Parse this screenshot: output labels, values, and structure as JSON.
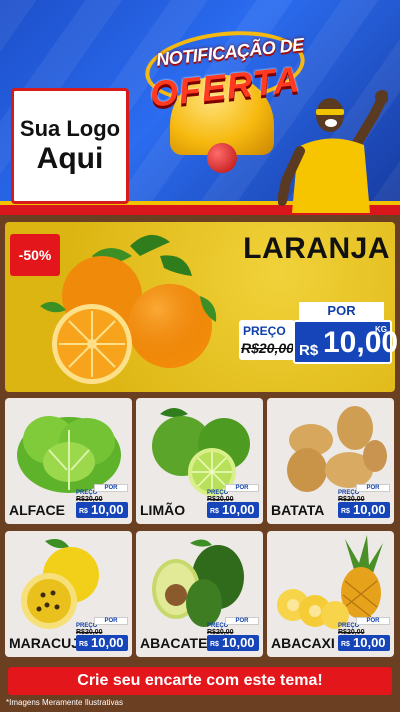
{
  "header": {
    "logo_line1": "Sua Logo",
    "logo_line2": "Aqui",
    "badge_line1": "NOTIFICAÇÃO DE",
    "badge_line2": "OFERTA"
  },
  "featured": {
    "discount": "-50%",
    "name": "LARANJA",
    "por_label": "POR",
    "preco_label": "PREÇO",
    "old_price": "R$20,00",
    "currency": "R$",
    "price": "10,00",
    "unit": "KG"
  },
  "products": [
    {
      "name": "ALFACE",
      "preco_label": "PREÇO",
      "old_price": "R$20,00",
      "por_label": "POR",
      "currency": "R$",
      "price": "10,00"
    },
    {
      "name": "LIMÃO",
      "preco_label": "PREÇO",
      "old_price": "R$20,00",
      "por_label": "POR",
      "currency": "R$",
      "price": "10,00"
    },
    {
      "name": "BATATA",
      "preco_label": "PREÇO",
      "old_price": "R$20,00",
      "por_label": "POR",
      "currency": "R$",
      "price": "10,00"
    },
    {
      "name": "MARACUJÁ",
      "preco_label": "PREÇO",
      "old_price": "R$20,00",
      "por_label": "POR",
      "currency": "R$",
      "price": "10,00"
    },
    {
      "name": "ABACATE",
      "preco_label": "PREÇO",
      "old_price": "R$20,00",
      "por_label": "POR",
      "currency": "R$",
      "price": "10,00"
    },
    {
      "name": "ABACAXI",
      "preco_label": "PREÇO",
      "old_price": "R$20,00",
      "por_label": "POR",
      "currency": "R$",
      "price": "10,00"
    }
  ],
  "cta": "Crie seu encarte com este tema!",
  "disclaimer": "*Imagens Meramente Ilustrativas",
  "colors": {
    "header_blue": "#1d4fc9",
    "accent_red": "#e3161b",
    "featured_yellow": "#e7c21e",
    "price_blue": "#1545b8",
    "wood": "#6b3f22"
  }
}
